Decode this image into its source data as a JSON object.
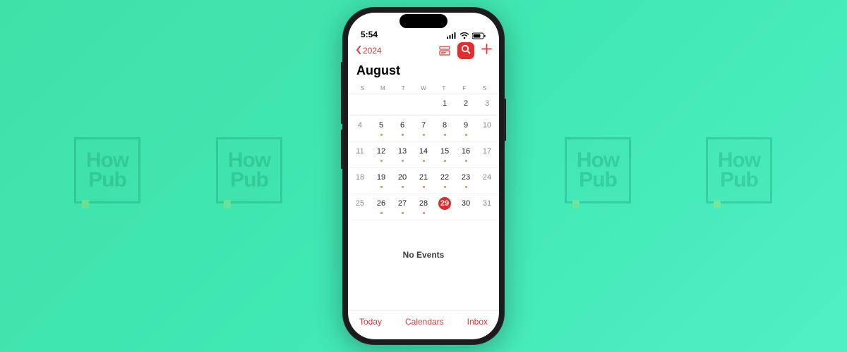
{
  "watermark": {
    "line1": "How",
    "line2": "Pub"
  },
  "status": {
    "time": "5:54"
  },
  "nav": {
    "back_year": "2024"
  },
  "month": {
    "title": "August"
  },
  "dow": [
    "S",
    "M",
    "T",
    "W",
    "T",
    "F",
    "S"
  ],
  "calendar": {
    "weeks": [
      {
        "days": [
          {
            "n": "",
            "this_month": false,
            "dot": false,
            "today": false
          },
          {
            "n": "",
            "this_month": false,
            "dot": false,
            "today": false
          },
          {
            "n": "",
            "this_month": false,
            "dot": false,
            "today": false
          },
          {
            "n": "",
            "this_month": false,
            "dot": false,
            "today": false
          },
          {
            "n": "1",
            "this_month": true,
            "dot": false,
            "today": false
          },
          {
            "n": "2",
            "this_month": true,
            "dot": false,
            "today": false
          },
          {
            "n": "3",
            "this_month": false,
            "dot": false,
            "today": false
          }
        ]
      },
      {
        "days": [
          {
            "n": "4",
            "this_month": false,
            "dot": false,
            "today": false
          },
          {
            "n": "5",
            "this_month": true,
            "dot": true,
            "today": false
          },
          {
            "n": "6",
            "this_month": true,
            "dot": true,
            "today": false
          },
          {
            "n": "7",
            "this_month": true,
            "dot": true,
            "today": false
          },
          {
            "n": "8",
            "this_month": true,
            "dot": true,
            "today": false
          },
          {
            "n": "9",
            "this_month": true,
            "dot": true,
            "today": false
          },
          {
            "n": "10",
            "this_month": false,
            "dot": false,
            "today": false
          }
        ]
      },
      {
        "days": [
          {
            "n": "11",
            "this_month": false,
            "dot": false,
            "today": false
          },
          {
            "n": "12",
            "this_month": true,
            "dot": true,
            "today": false
          },
          {
            "n": "13",
            "this_month": true,
            "dot": true,
            "today": false
          },
          {
            "n": "14",
            "this_month": true,
            "dot": true,
            "today": false
          },
          {
            "n": "15",
            "this_month": true,
            "dot": true,
            "today": false
          },
          {
            "n": "16",
            "this_month": true,
            "dot": true,
            "today": false
          },
          {
            "n": "17",
            "this_month": false,
            "dot": false,
            "today": false
          }
        ]
      },
      {
        "days": [
          {
            "n": "18",
            "this_month": false,
            "dot": false,
            "today": false
          },
          {
            "n": "19",
            "this_month": true,
            "dot": true,
            "today": false
          },
          {
            "n": "20",
            "this_month": true,
            "dot": true,
            "today": false
          },
          {
            "n": "21",
            "this_month": true,
            "dot": true,
            "today": false
          },
          {
            "n": "22",
            "this_month": true,
            "dot": true,
            "today": false
          },
          {
            "n": "23",
            "this_month": true,
            "dot": true,
            "today": false
          },
          {
            "n": "24",
            "this_month": false,
            "dot": false,
            "today": false
          }
        ]
      },
      {
        "days": [
          {
            "n": "25",
            "this_month": false,
            "dot": false,
            "today": false
          },
          {
            "n": "26",
            "this_month": true,
            "dot": true,
            "today": false
          },
          {
            "n": "27",
            "this_month": true,
            "dot": true,
            "today": false
          },
          {
            "n": "28",
            "this_month": true,
            "dot": true,
            "today": false
          },
          {
            "n": "29",
            "this_month": true,
            "dot": false,
            "today": true
          },
          {
            "n": "30",
            "this_month": true,
            "dot": false,
            "today": false
          },
          {
            "n": "31",
            "this_month": false,
            "dot": false,
            "today": false
          }
        ]
      }
    ]
  },
  "empty_state": "No Events",
  "toolbar": {
    "today": "Today",
    "calendars": "Calendars",
    "inbox": "Inbox"
  }
}
